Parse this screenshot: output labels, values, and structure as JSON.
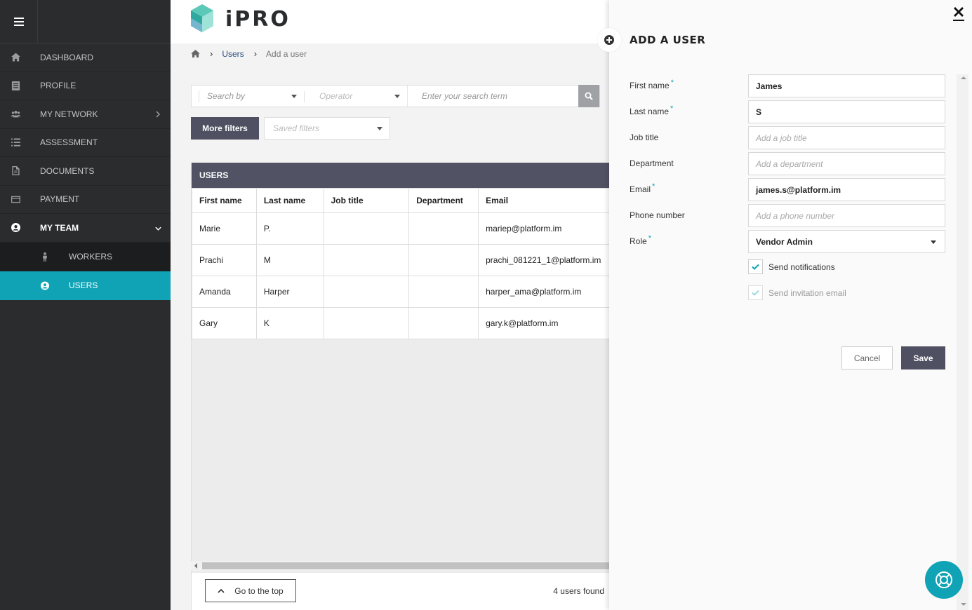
{
  "sidebar": {
    "items": [
      {
        "label": "DASHBOARD",
        "icon": "home-icon"
      },
      {
        "label": "PROFILE",
        "icon": "profile-icon"
      },
      {
        "label": "MY NETWORK",
        "icon": "network-icon"
      },
      {
        "label": "ASSESSMENT",
        "icon": "list-icon"
      },
      {
        "label": "DOCUMENTS",
        "icon": "document-icon"
      },
      {
        "label": "PAYMENT",
        "icon": "credit-card-icon"
      },
      {
        "label": "MY TEAM",
        "icon": "user-circle-icon"
      }
    ],
    "sub_items": [
      {
        "label": "WORKERS",
        "icon": "worker-icon"
      },
      {
        "label": "USERS",
        "icon": "user-circle-icon"
      }
    ]
  },
  "header": {
    "logo_text": "iPRO"
  },
  "breadcrumb": {
    "link": "Users",
    "current": "Add a user"
  },
  "search": {
    "search_by": "Search by",
    "operator": "Operator",
    "term_placeholder": "Enter your search term"
  },
  "filters": {
    "more_filters": "More filters",
    "saved_filters": "Saved filters"
  },
  "users_table": {
    "title": "USERS",
    "columns": [
      "First name",
      "Last name",
      "Job title",
      "Department",
      "Email"
    ],
    "rows": [
      [
        "Marie",
        "P.",
        "",
        "",
        "mariep@platform.im"
      ],
      [
        "Prachi",
        "M",
        "",
        "",
        "prachi_081221_1@platform.im"
      ],
      [
        "Amanda",
        "Harper",
        "",
        "",
        "harper_ama@platform.im"
      ],
      [
        "Gary",
        "K",
        "",
        "",
        "gary.k@platform.im"
      ]
    ]
  },
  "footer": {
    "go_top": "Go to the top",
    "count": "4 users found"
  },
  "panel": {
    "title": "ADD A USER",
    "fields": {
      "first_name": {
        "label": "First name",
        "value": "James"
      },
      "last_name": {
        "label": "Last name",
        "value": "S"
      },
      "job_title": {
        "label": "Job title",
        "placeholder": "Add a job title"
      },
      "department": {
        "label": "Department",
        "placeholder": "Add a department"
      },
      "email": {
        "label": "Email",
        "value": "james.s@platform.im"
      },
      "phone": {
        "label": "Phone number",
        "placeholder": "Add a phone number"
      },
      "role": {
        "label": "Role",
        "value": "Vendor Admin"
      }
    },
    "required_mark": "*",
    "send_notifications": {
      "label": "Send notifications",
      "checked": true
    },
    "send_invitation": {
      "label": "Send invitation email",
      "checked": true,
      "disabled": true
    },
    "cancel": "Cancel",
    "save": "Save"
  },
  "colors": {
    "accent": "#0fa3b5",
    "sidebar": "#2b2c2e",
    "dark_button": "#4f5162"
  }
}
